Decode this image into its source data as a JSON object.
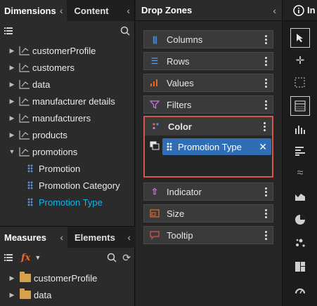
{
  "left_panel": {
    "tabs": {
      "dimensions": "Dimensions",
      "content": "Content"
    },
    "tree": [
      {
        "label": "customerProfile",
        "expanded": false
      },
      {
        "label": "customers",
        "expanded": false
      },
      {
        "label": "data",
        "expanded": false
      },
      {
        "label": "manufacturer details",
        "expanded": false
      },
      {
        "label": "manufacturers",
        "expanded": false
      },
      {
        "label": "products",
        "expanded": false
      },
      {
        "label": "promotions",
        "expanded": true
      }
    ],
    "promotion_fields": [
      "Promotion",
      "Promotion Category",
      "Promotion Type"
    ],
    "selected_field": "Promotion Type",
    "measures_tabs": {
      "measures": "Measures",
      "elements": "Elements"
    },
    "measures_tree": [
      "customerProfile",
      "data"
    ]
  },
  "drop_zones": {
    "title": "Drop Zones",
    "zones": {
      "columns": "Columns",
      "rows": "Rows",
      "values": "Values",
      "filters": "Filters",
      "color": "Color",
      "indicator": "Indicator",
      "size": "Size",
      "tooltip": "Tooltip"
    },
    "color_chip": "Promotion Type"
  },
  "right_toolbar": {
    "title": "In"
  },
  "colors": {
    "accent_blue": "#2f6db5",
    "selected_text": "#19b2e8",
    "highlight_red": "#d9534f",
    "folder": "#d8a24a"
  }
}
